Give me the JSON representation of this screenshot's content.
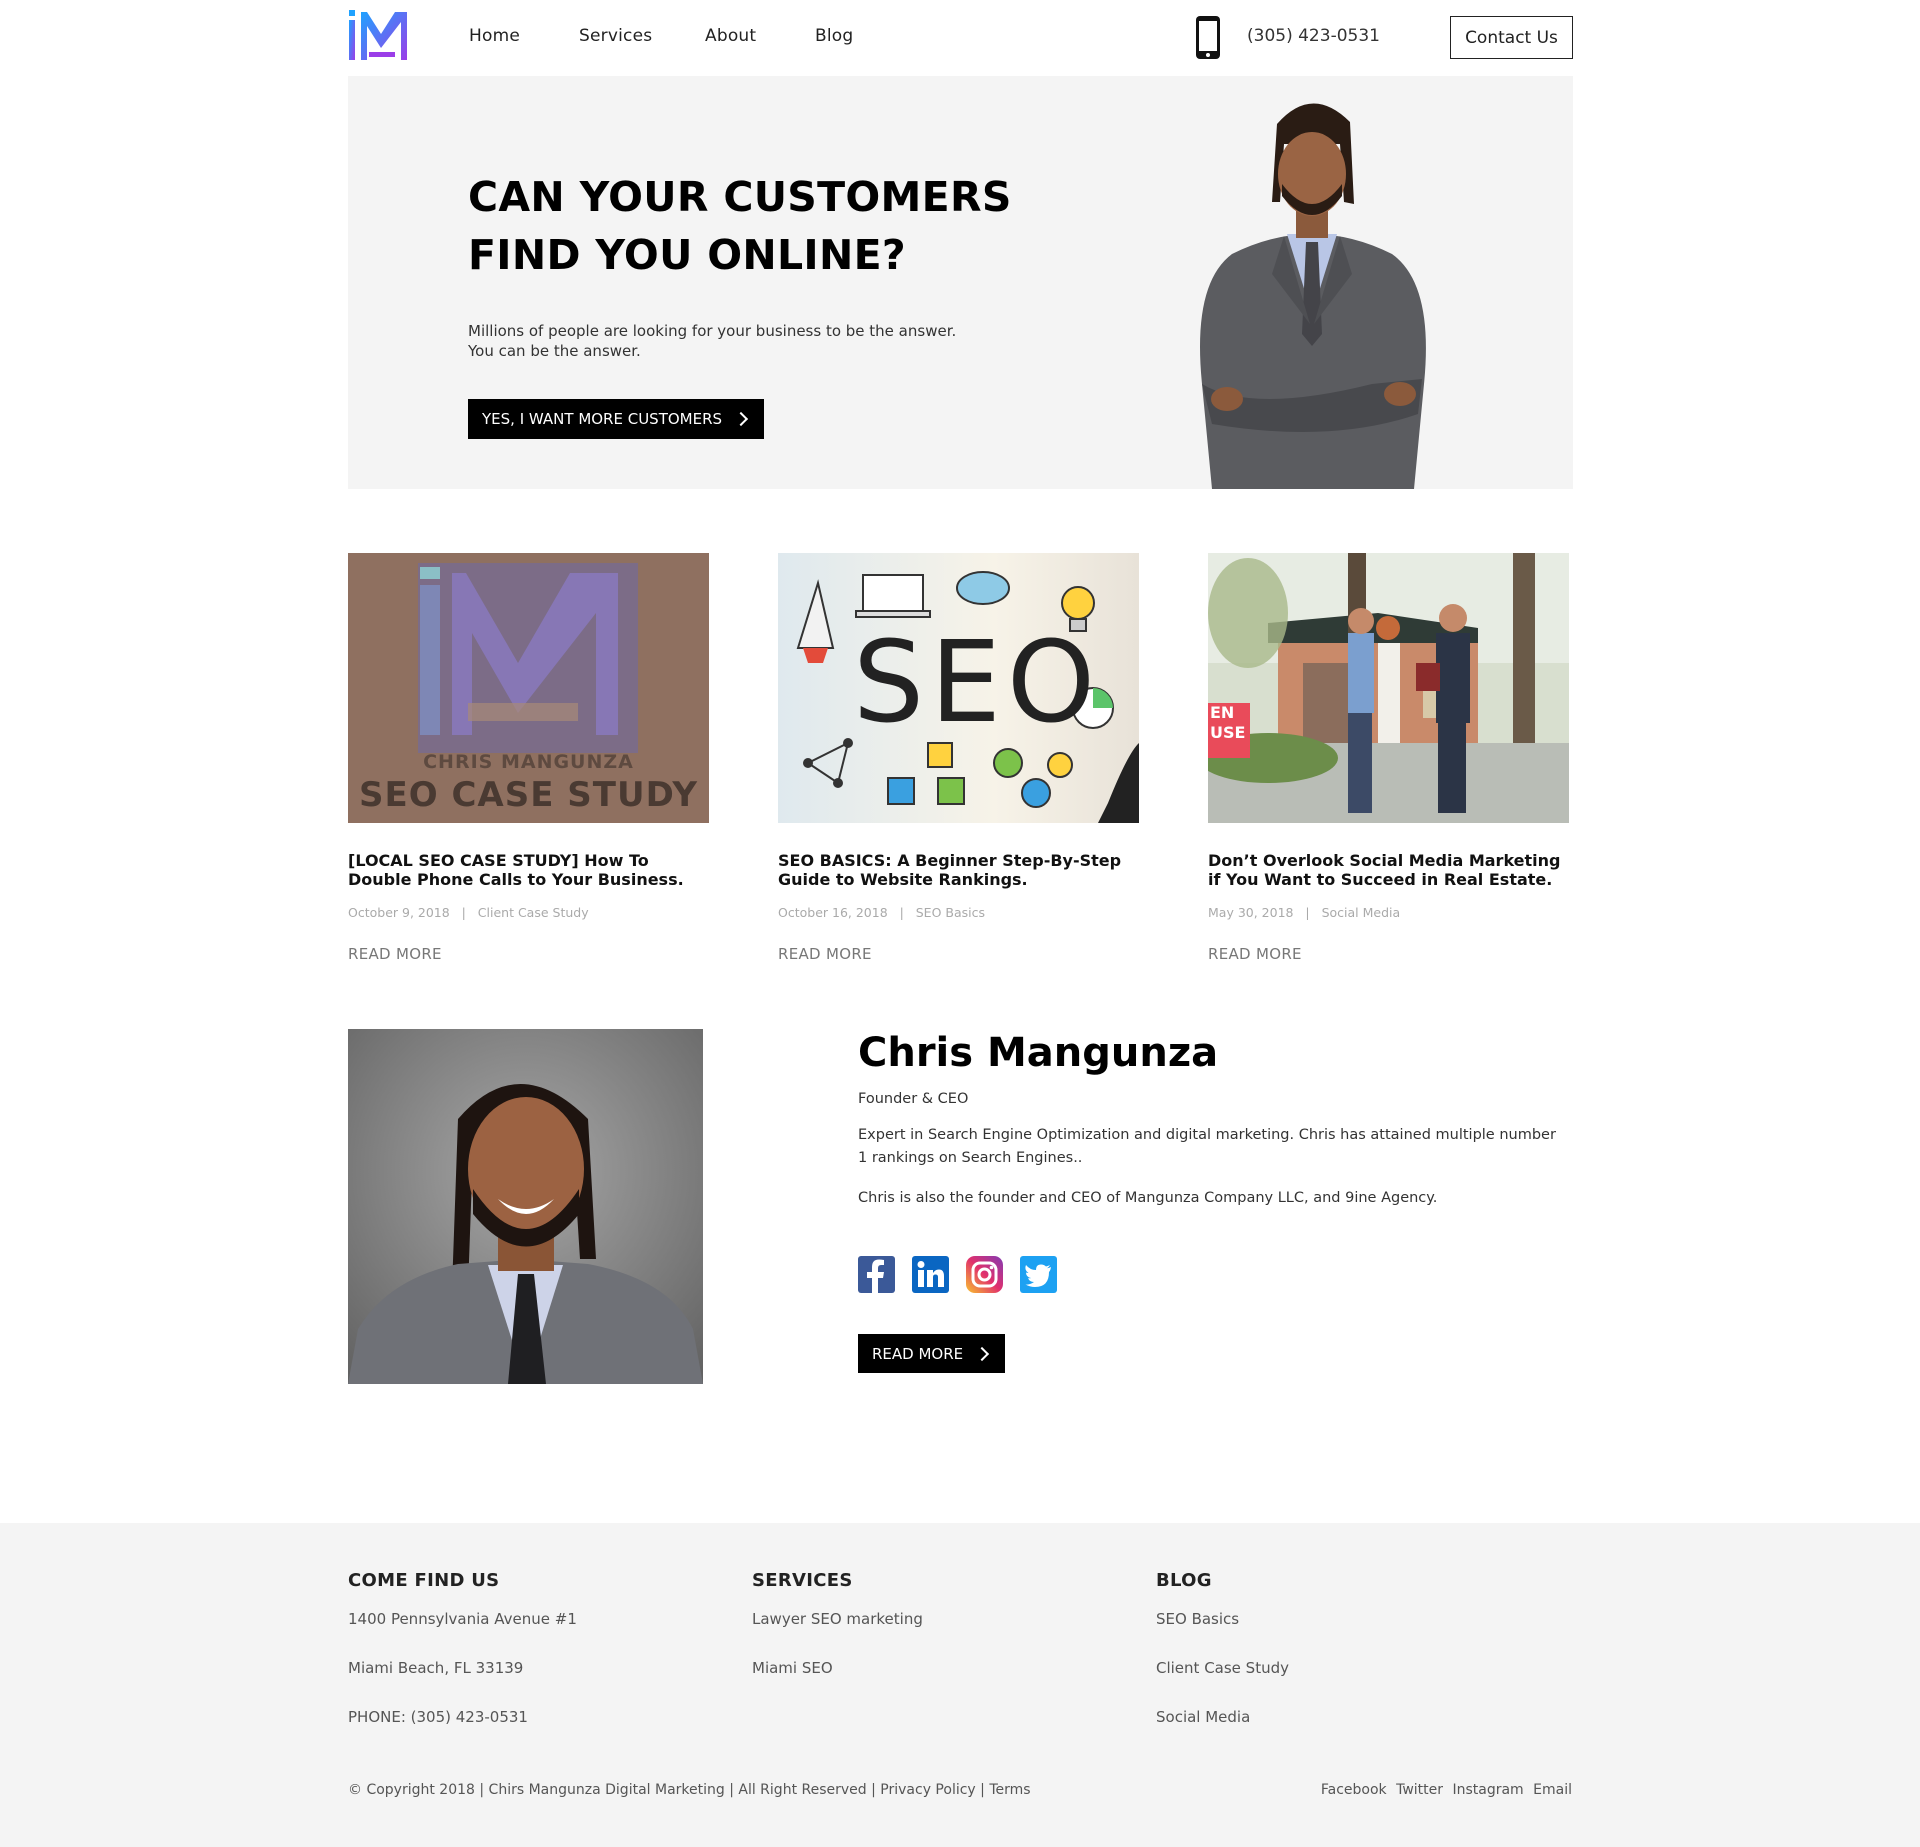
{
  "header": {
    "nav": [
      "Home",
      "Services",
      "About",
      "Blog"
    ],
    "phone": "(305) 423-0531",
    "contact_label": "Contact Us"
  },
  "hero": {
    "title_line1": "CAN YOUR CUSTOMERS",
    "title_line2": "FIND YOU ONLINE?",
    "subtitle_line1": "Millions of people are looking for your business to be the answer.",
    "subtitle_line2": "You can be the answer.",
    "cta": "YES, I WANT MORE CUSTOMERS"
  },
  "posts": [
    {
      "image_text_top": "CHRIS MANGUNZA",
      "image_text_bottom": "SEO CASE STUDY",
      "title": "[LOCAL SEO CASE STUDY] How To Double Phone Calls to Your Business.",
      "date": "October 9, 2018",
      "category": "Client Case Study",
      "read_more": "READ MORE"
    },
    {
      "image_text": "SEO",
      "title": "SEO BASICS: A Beginner Step-By-Step Guide to Website Rankings.",
      "date": "October 16, 2018",
      "category": "SEO Basics",
      "read_more": "READ MORE"
    },
    {
      "image_text": "EN USE",
      "title": "Don’t Overlook Social Media Marketing if You Want to Succeed in Real Estate.",
      "date": "May 30, 2018",
      "category": "Social Media",
      "read_more": "READ MORE"
    }
  ],
  "about": {
    "name": "Chris Mangunza",
    "role": "Founder & CEO",
    "p1": "Expert in Search Engine Optimization and digital marketing. Chris has attained multiple number 1 rankings on Search Engines..",
    "p2": "Chris is also the founder and CEO of Mangunza Company LLC, and 9ine Agency.",
    "read_more": "READ MORE",
    "social_icons": [
      "facebook-icon",
      "linkedin-icon",
      "instagram-icon",
      "twitter-icon"
    ]
  },
  "footer": {
    "col1": {
      "heading": "COME FIND US",
      "items": [
        "1400 Pennsylvania Avenue #1",
        "Miami Beach, FL 33139",
        "PHONE: (305) 423-0531"
      ]
    },
    "col2": {
      "heading": "SERVICES",
      "items": [
        "Lawyer SEO marketing",
        "Miami SEO"
      ]
    },
    "col3": {
      "heading": "BLOG",
      "items": [
        "SEO Basics",
        "Client Case Study",
        "Social Media"
      ]
    },
    "copyright": "© Copyright 2018 | Chirs Mangunza Digital Marketing | All Right Reserved |",
    "privacy": "Privacy Policy",
    "sep": "|",
    "terms": "Terms",
    "social": [
      "Facebook",
      "Twitter",
      "Instagram",
      "Email"
    ]
  },
  "colors": {
    "accent_black": "#000000",
    "hero_bg": "#f4f4f4",
    "footer_bg": "#f4f4f4",
    "logo_blue": "#2a7fe0",
    "logo_purple": "#8a3ee0",
    "facebook": "#3b5998",
    "linkedin": "#0a66c2",
    "twitter": "#1da1f2"
  }
}
